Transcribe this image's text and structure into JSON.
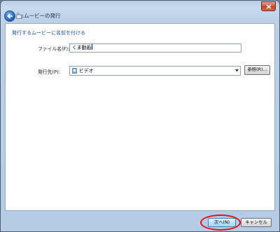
{
  "window": {
    "title": "ムービーの発行"
  },
  "colors": {
    "heading": "#1f4fa6",
    "highlight": "#e01212",
    "close_button": "#c7442c"
  },
  "icons": {
    "back": "back-arrow-icon",
    "app": "movie-app-icon",
    "close": "close-icon",
    "folder": "video-folder-icon",
    "dropdown": "chevron-down-icon"
  },
  "main": {
    "heading": "発行するムービーに名前を付ける",
    "filename_label": "ファイル名(F):",
    "filename_value": "くま動画",
    "destination_label": "発行先(P):",
    "destination_value": "ビデオ",
    "browse_label": "参照(R)..."
  },
  "footer": {
    "next_label": "次へ(N)",
    "cancel_label": "キャンセル"
  }
}
